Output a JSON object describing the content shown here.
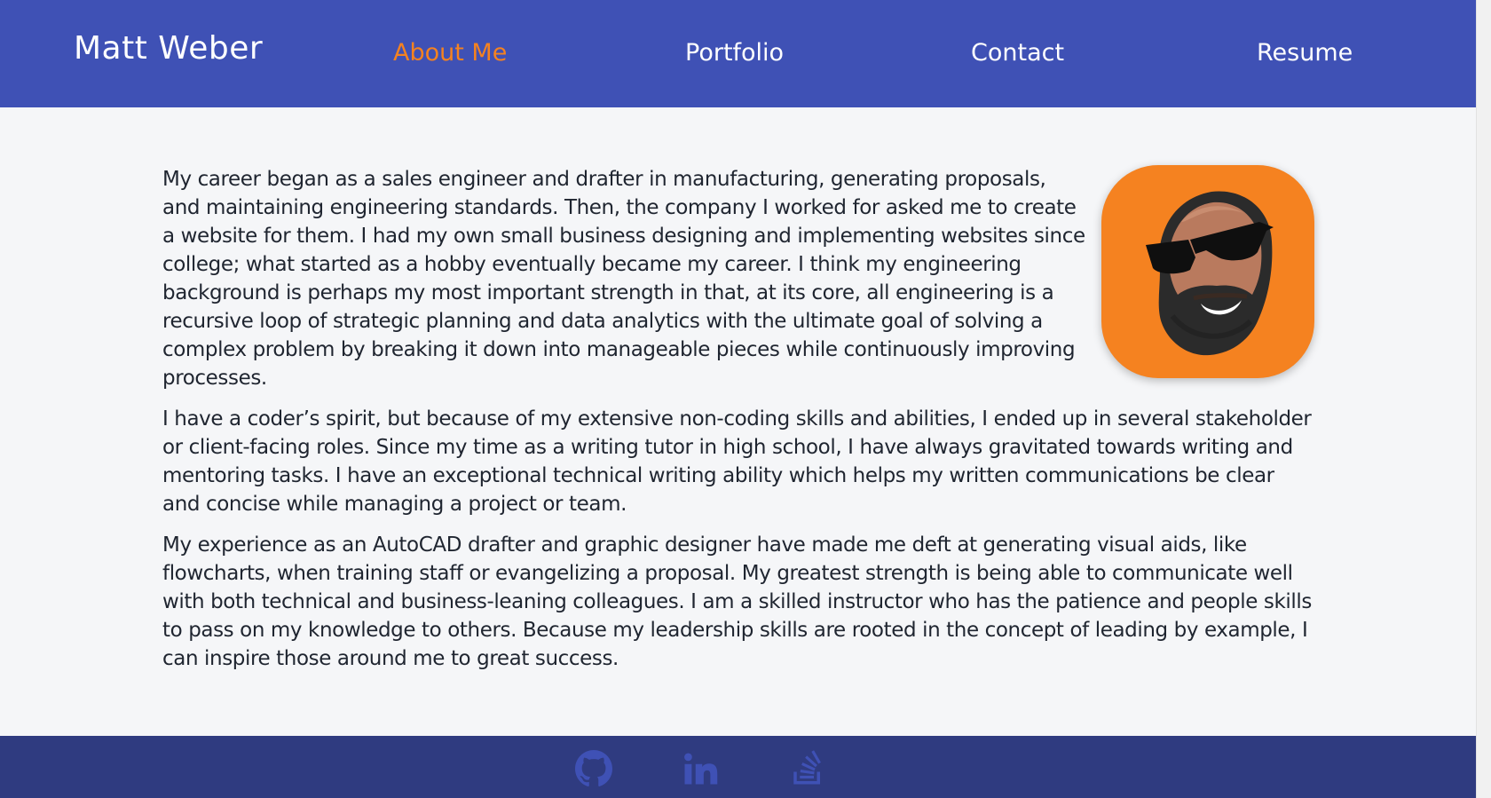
{
  "header": {
    "brand": "Matt Weber",
    "nav": [
      {
        "label": "About Me",
        "active": true
      },
      {
        "label": "Portfolio",
        "active": false
      },
      {
        "label": "Contact",
        "active": false
      },
      {
        "label": "Resume",
        "active": false
      }
    ]
  },
  "main": {
    "paragraphs": [
      "My career began as a sales engineer and drafter in manufacturing, generating proposals, and maintaining engineering standards. Then, the company I worked for asked me to create a website for them. I had my own small business designing and implementing websites since college; what started as a hobby eventually became my career. I think my engineering background is perhaps my most important strength in that, at its core, all engineering is a recursive loop of strategic planning and data analytics with the ultimate goal of solving a complex problem by breaking it down into manageable pieces while continuously improving processes.",
      "I have a coder’s spirit, but because of my extensive non-coding skills and abilities, I ended up in several stakeholder or client-facing roles. Since my time as a writing tutor in high school, I have always gravitated towards writing and mentoring tasks. I have an exceptional technical writing ability which helps my written communications be clear and concise while managing a project or team.",
      "My experience as an AutoCAD drafter and graphic designer have made me deft at generating visual aids, like flowcharts, when training staff or evangelizing a proposal. My greatest strength is being able to communicate well with both technical and business-leaning colleagues. I am a skilled instructor who has the patience and people skills to pass on my knowledge to others. Because my leadership skills are rooted in the concept of leading by example, I can inspire those around me to great success."
    ]
  },
  "footer": {
    "icons": [
      "github-icon",
      "linkedin-icon",
      "stack-overflow-icon"
    ]
  },
  "colors": {
    "header_bg": "#3f51b5",
    "footer_bg": "#2f3b80",
    "accent": "#f58220",
    "page_bg": "#f5f6f8",
    "text": "#1f2530"
  }
}
